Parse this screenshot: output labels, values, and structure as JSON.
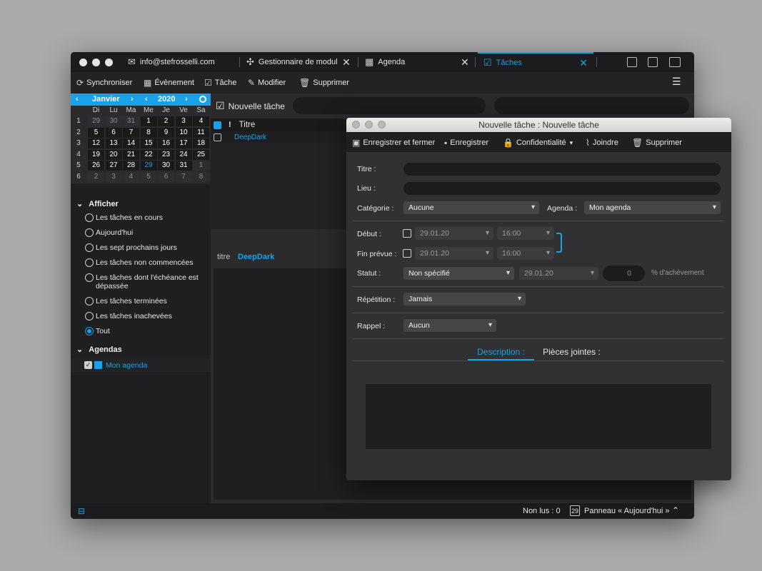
{
  "titlebar": {
    "tabs": [
      {
        "label": "info@stefrosselli.com"
      },
      {
        "label": "Gestionnaire de modul"
      },
      {
        "label": "Agenda"
      },
      {
        "label": "Tâches"
      }
    ]
  },
  "toolbar": {
    "sync": "Synchroniser",
    "event": "Évènement",
    "task": "Tâche",
    "edit": "Modifier",
    "delete": "Supprimer"
  },
  "calendar": {
    "month": "Janvier",
    "year": "2020",
    "weekdays": [
      "Di",
      "Lu",
      "Ma",
      "Me",
      "Je",
      "Ve",
      "Sa"
    ],
    "weeks": [
      {
        "num": "1",
        "days": [
          "29",
          "30",
          "31",
          "1",
          "2",
          "3",
          "4"
        ]
      },
      {
        "num": "2",
        "days": [
          "5",
          "6",
          "7",
          "8",
          "9",
          "10",
          "11"
        ]
      },
      {
        "num": "3",
        "days": [
          "12",
          "13",
          "14",
          "15",
          "16",
          "17",
          "18"
        ]
      },
      {
        "num": "4",
        "days": [
          "19",
          "20",
          "21",
          "22",
          "23",
          "24",
          "25"
        ]
      },
      {
        "num": "5",
        "days": [
          "26",
          "27",
          "28",
          "29",
          "30",
          "31",
          "1"
        ]
      },
      {
        "num": "6",
        "days": [
          "2",
          "3",
          "4",
          "5",
          "6",
          "7",
          "8"
        ]
      }
    ],
    "today": "29"
  },
  "sidebar": {
    "show_header": "Afficher",
    "filters": [
      "Les tâches en cours",
      "Aujourd'hui",
      "Les sept prochains jours",
      "Les tâches non commencées",
      "Les tâches dont l'échéance est dépassée",
      "Les tâches terminées",
      "Les tâches inachevées",
      "Tout"
    ],
    "selected_filter": "Tout",
    "agendas_header": "Agendas",
    "agenda_name": "Mon agenda",
    "agenda_color": "#1aa1e8"
  },
  "tasklist": {
    "new_task": "Nouvelle tâche",
    "col_priority": "!",
    "col_title": "Titre",
    "rows": [
      {
        "title": "DeepDark"
      }
    ],
    "detail_label": "titre",
    "detail_value": "DeepDark"
  },
  "statusbar": {
    "unread": "Non lus : 0",
    "today_day": "29",
    "today_panel": "Panneau « Aujourd'hui »"
  },
  "dialog": {
    "title": "Nouvelle tâche : Nouvelle tâche",
    "toolbar": {
      "save_close": "Enregistrer et fermer",
      "save": "Enregistrer",
      "privacy": "Confidentialité",
      "attach": "Joindre",
      "delete": "Supprimer"
    },
    "title_label": "Titre :",
    "location_label": "Lieu :",
    "category_label": "Catégorie :",
    "category_value": "Aucune",
    "agenda_label": "Agenda :",
    "agenda_value": "Mon agenda",
    "start_label": "Début :",
    "start_date": "29.01.20",
    "start_time": "16:00",
    "due_label": "Fin prévue :",
    "due_date": "29.01.20",
    "due_time": "16:00",
    "status_label": "Statut :",
    "status_value": "Non spécifié",
    "status_date": "29.01.20",
    "percent_value": "0",
    "percent_label": "% d'achèvement",
    "repeat_label": "Répétition :",
    "repeat_value": "Jamais",
    "reminder_label": "Rappel :",
    "reminder_value": "Aucun",
    "tab_description": "Description :",
    "tab_attachments": "Pièces jointes :"
  },
  "colors": {
    "accent": "#1aa1e8",
    "window_bg": "#2b2b2d",
    "titlebar_bg": "#1c1c1e"
  }
}
